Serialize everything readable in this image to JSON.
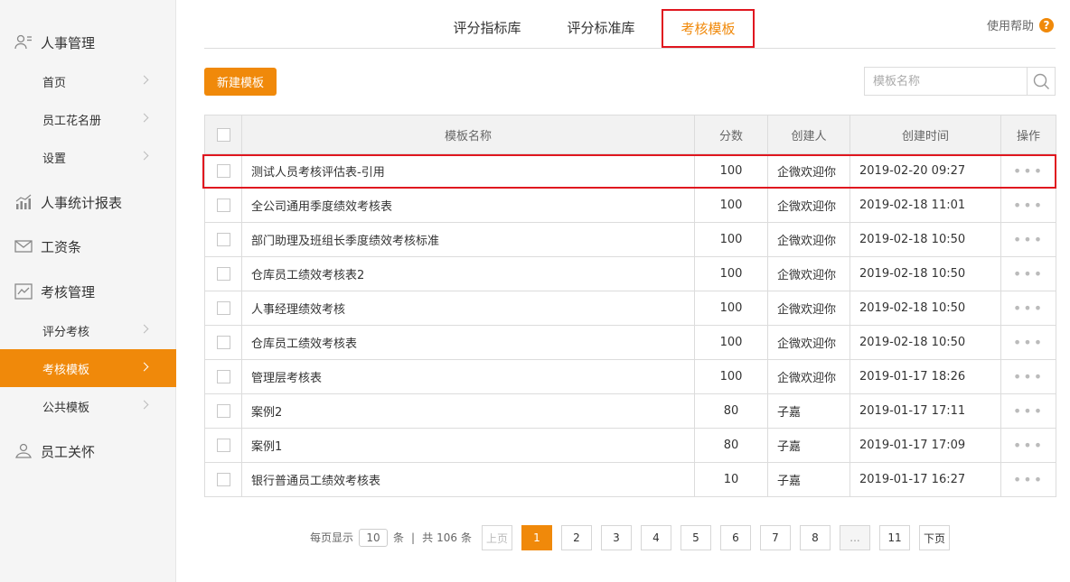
{
  "sidebar": {
    "sections": [
      {
        "label": "人事管理",
        "icon": "user-info-icon"
      },
      {
        "label": "人事统计报表",
        "icon": "bar-chart-icon"
      },
      {
        "label": "工资条",
        "icon": "mail-icon"
      },
      {
        "label": "考核管理",
        "icon": "line-chart-icon"
      },
      {
        "label": "员工关怀",
        "icon": "care-icon"
      }
    ],
    "hr_items": [
      "首页",
      "员工花名册",
      "设置"
    ],
    "assess_items": [
      "评分考核",
      "考核模板",
      "公共模板"
    ],
    "active_item": "考核模板"
  },
  "tabs": [
    "评分指标库",
    "评分标准库",
    "考核模板"
  ],
  "active_tab": "考核模板",
  "help_label": "使用帮助",
  "help_icon": "?",
  "toolbar": {
    "new_button": "新建模板",
    "search_placeholder": "模板名称"
  },
  "table": {
    "headers": [
      "模板名称",
      "分数",
      "创建人",
      "创建时间",
      "操作"
    ],
    "rows": [
      {
        "name": "测试人员考核评估表-引用",
        "score": "100",
        "creator": "企微欢迎你",
        "time": "2019-02-20 09:27",
        "op": "•••"
      },
      {
        "name": "全公司通用季度绩效考核表",
        "score": "100",
        "creator": "企微欢迎你",
        "time": "2019-02-18 11:01",
        "op": "•••"
      },
      {
        "name": "部门助理及班组长季度绩效考核标准",
        "score": "100",
        "creator": "企微欢迎你",
        "time": "2019-02-18 10:50",
        "op": "•••"
      },
      {
        "name": "仓库员工绩效考核表2",
        "score": "100",
        "creator": "企微欢迎你",
        "time": "2019-02-18 10:50",
        "op": "•••"
      },
      {
        "name": "人事经理绩效考核",
        "score": "100",
        "creator": "企微欢迎你",
        "time": "2019-02-18 10:50",
        "op": "•••"
      },
      {
        "name": "仓库员工绩效考核表",
        "score": "100",
        "creator": "企微欢迎你",
        "time": "2019-02-18 10:50",
        "op": "•••"
      },
      {
        "name": "管理层考核表",
        "score": "100",
        "creator": "企微欢迎你",
        "time": "2019-01-17 18:26",
        "op": "•••"
      },
      {
        "name": "案例2",
        "score": "80",
        "creator": "子嘉",
        "time": "2019-01-17 17:11",
        "op": "•••"
      },
      {
        "name": "案例1",
        "score": "80",
        "creator": "子嘉",
        "time": "2019-01-17 17:09",
        "op": "•••"
      },
      {
        "name": "银行普通员工绩效考核表",
        "score": "10",
        "creator": "子嘉",
        "time": "2019-01-17 16:27",
        "op": "•••"
      }
    ]
  },
  "pagination": {
    "per_page_prefix": "每页显示",
    "per_page_value": "10",
    "per_page_suffix": "条",
    "separator": "|",
    "total_prefix": "共",
    "total_value": "106",
    "total_suffix": "条",
    "prev": "上页",
    "next": "下页",
    "pages": [
      "1",
      "2",
      "3",
      "4",
      "5",
      "6",
      "7",
      "8",
      "...",
      "11"
    ],
    "current": "1"
  },
  "colors": {
    "accent": "#f0890a",
    "highlight_border": "#e0161f"
  }
}
